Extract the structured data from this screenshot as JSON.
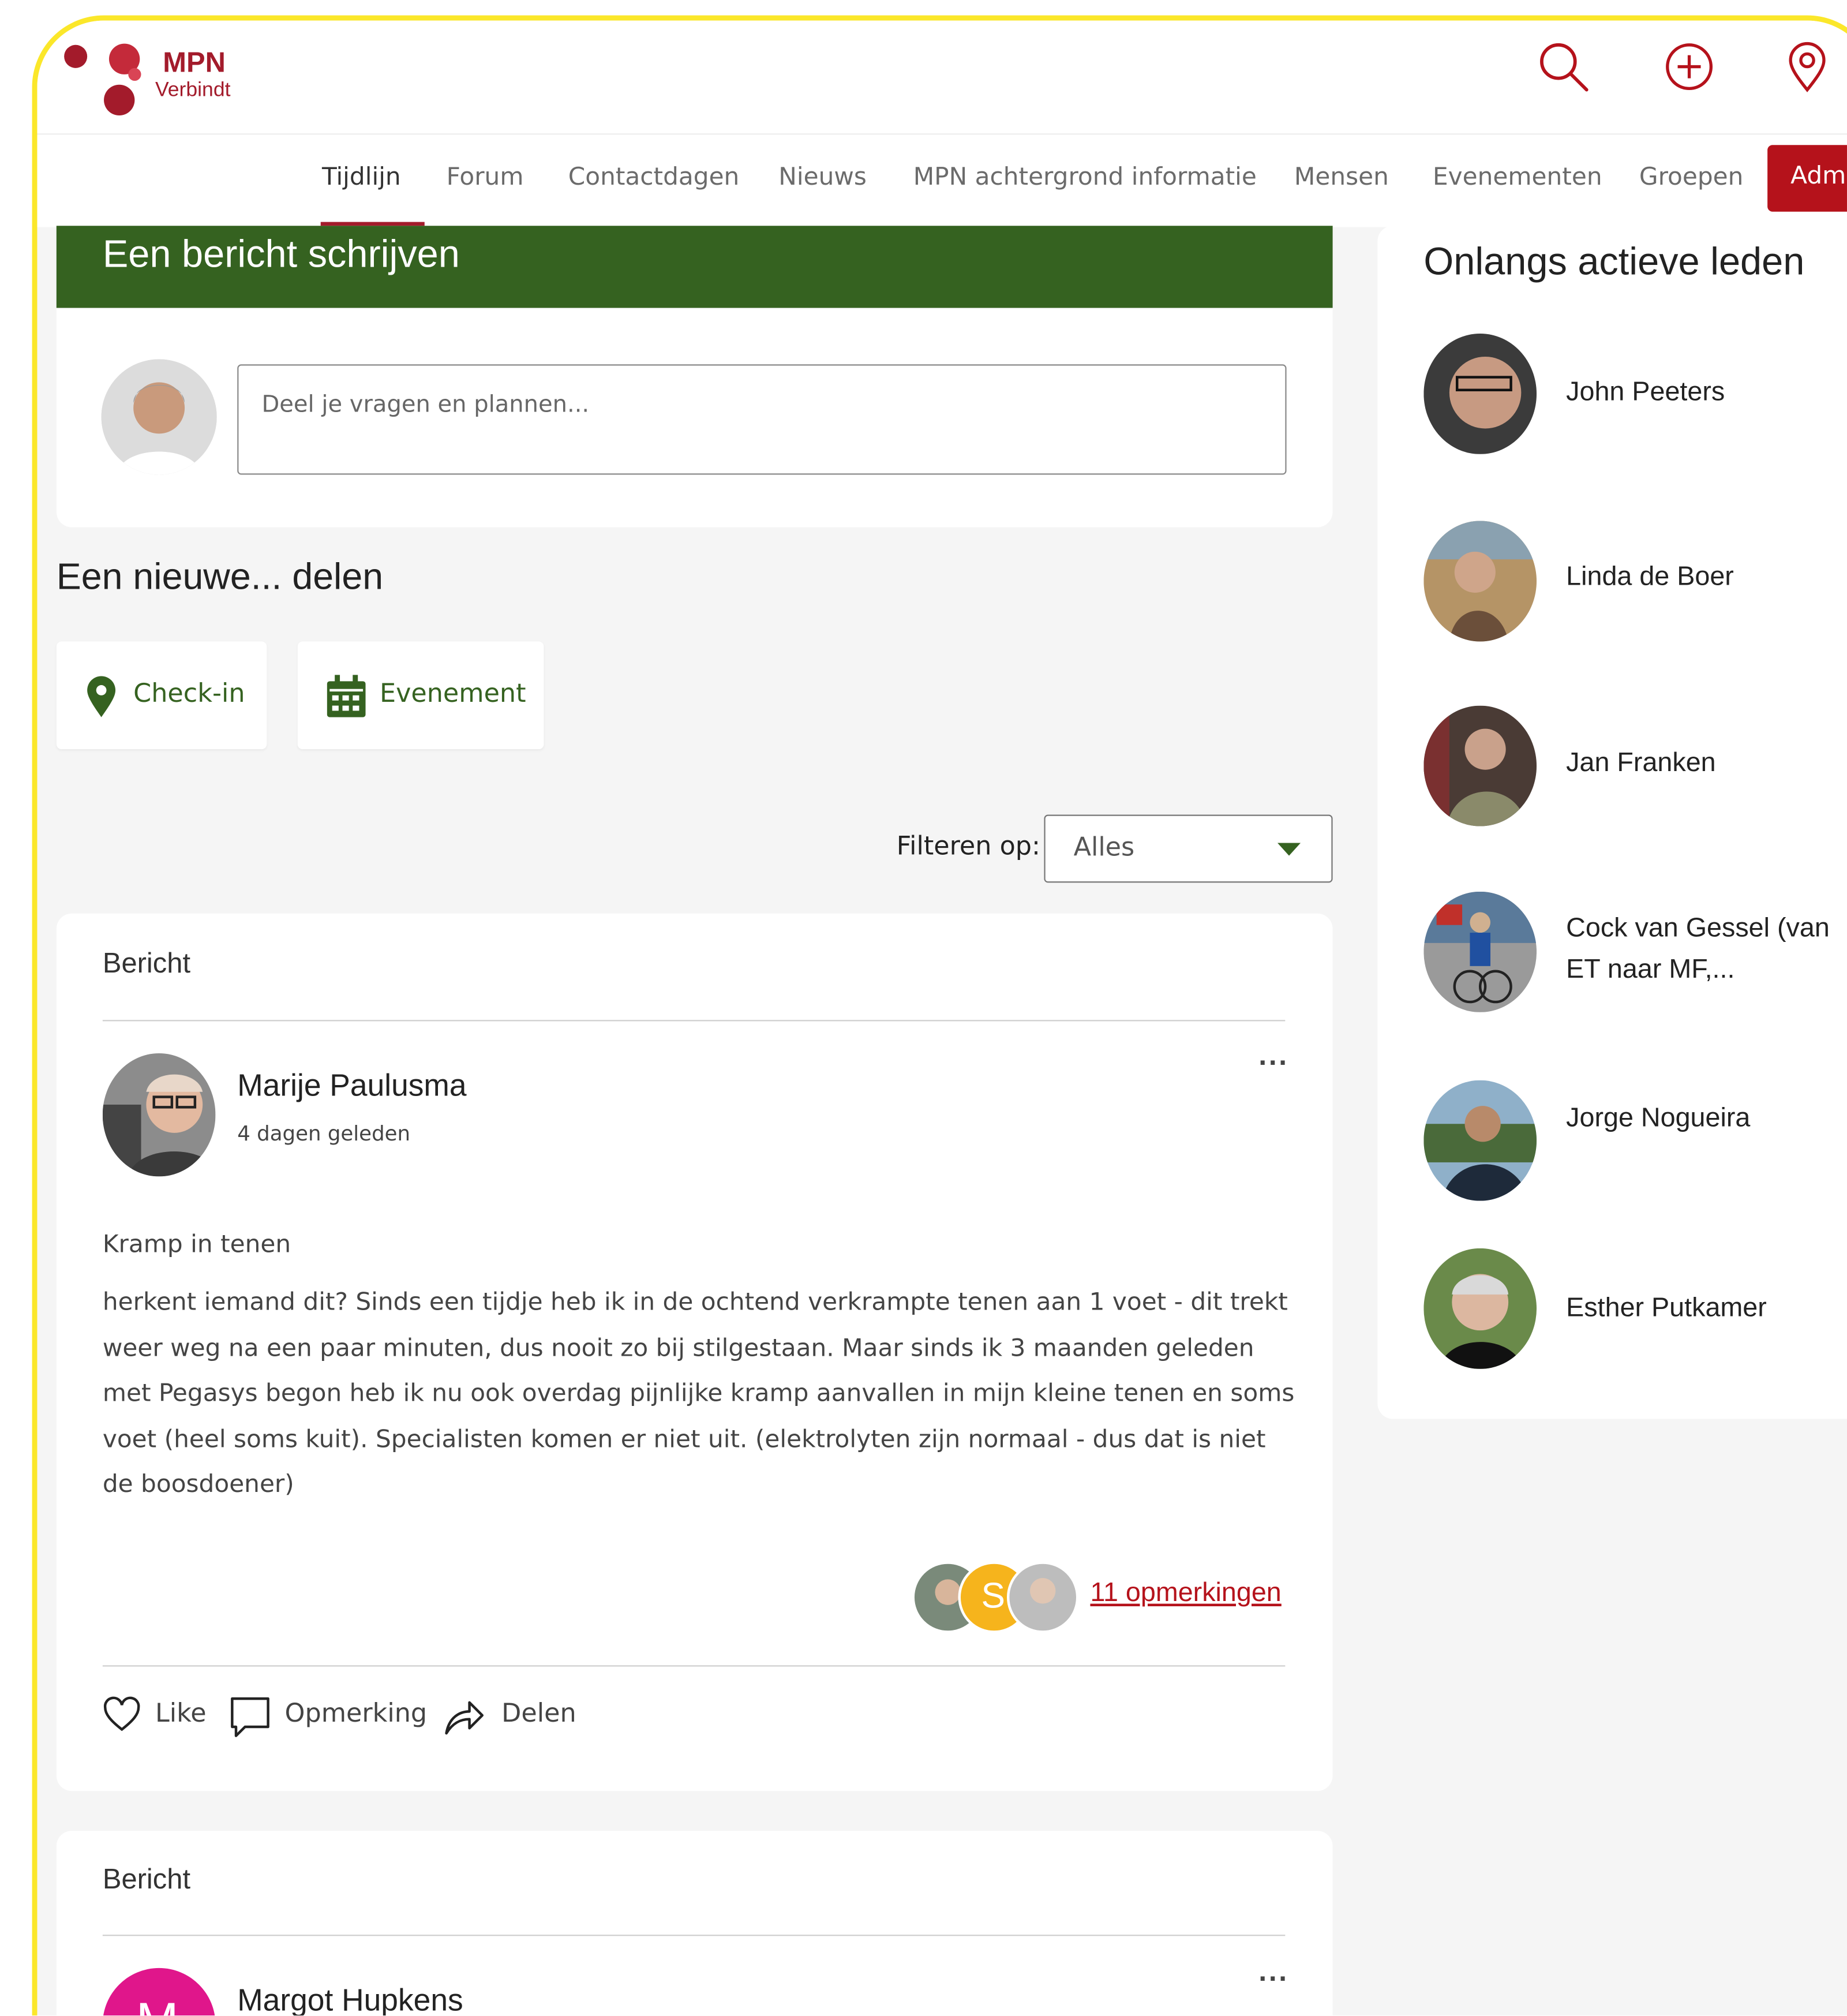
{
  "app": {
    "logo_line1": "MPN",
    "logo_line2": "Verbindt"
  },
  "header_icons": [
    "search-icon",
    "plus-circle-icon",
    "location-pin-icon"
  ],
  "nav": {
    "items": [
      "Tijdlijn",
      "Forum",
      "Contactdagen",
      "Nieuws",
      "MPN achtergrond informatie",
      "Mensen",
      "Evenementen",
      "Groepen"
    ],
    "admin_label": "Admin",
    "active": "Tijdlijn"
  },
  "composer": {
    "title": "Een bericht schrijven",
    "placeholder": "Deel je vragen en plannen..."
  },
  "share": {
    "title": "Een nieuwe... delen",
    "checkin": "Check-in",
    "event": "Evenement"
  },
  "filter": {
    "label": "Filteren op:",
    "value": "Alles"
  },
  "posts": [
    {
      "type": "Bericht",
      "author": "Marije Paulusma",
      "time": "4 dagen geleden",
      "title": "Kramp in tenen",
      "body": "herkent iemand dit? Sinds een tijdje heb ik in de ochtend verkrampte tenen aan 1 voet - dit trekt weer weg na een paar minuten, dus nooit zo bij stilgestaan. Maar sinds ik 3 maanden geleden met Pegasys begon heb ik nu ook overdag pijnlijke kramp aanvallen in mijn kleine tenen en soms voet (heel soms kuit). Specialisten komen er niet uit. (elektrolyten zijn normaal - dus dat is niet de boosdoener)",
      "commenter_initial": "S",
      "comments_label": "11 opmerkingen",
      "actions": {
        "like": "Like",
        "comment": "Opmerking",
        "share": "Delen"
      },
      "more": "..."
    },
    {
      "type": "Bericht",
      "author": "Margot Hupkens",
      "avatar_initial": "M",
      "more": "..."
    }
  ],
  "sidebar": {
    "title": "Onlangs actieve leden",
    "members": [
      {
        "name": "John Peeters"
      },
      {
        "name": "Linda de Boer"
      },
      {
        "name": "Jan Franken"
      },
      {
        "name": "Cock van Gessel (van ET naar MF,..."
      },
      {
        "name": "Jorge Nogueira"
      },
      {
        "name": "Esther Putkamer"
      }
    ]
  },
  "colors": {
    "brand_red": "#b5121b",
    "brand_green": "#356220",
    "frame_yellow": "#fbe72a"
  }
}
